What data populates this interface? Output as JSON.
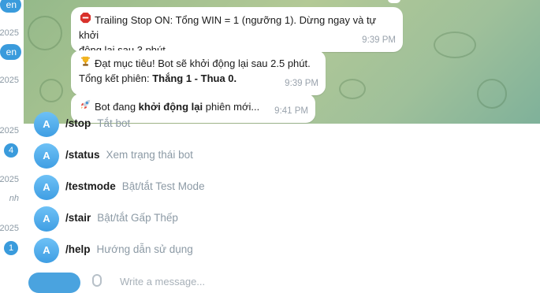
{
  "chat_list": {
    "years": [
      "2025",
      "2025",
      "2025",
      "2025",
      "2025",
      "2025"
    ],
    "pills": [
      "en",
      "en"
    ],
    "badges": [
      "4",
      "1"
    ],
    "italic_snippet": "nh"
  },
  "messages": [
    {
      "icon": "stop-sign-icon",
      "text_line1": "Trailing Stop ON: Tổng WIN = 1 (ngưỡng 1). Dừng ngay và tự khởi",
      "text_line2": "động lại sau 3 phút.",
      "time": "9:39 PM"
    },
    {
      "icon": "trophy-icon",
      "text_line1": "Đạt mục tiêu! Bot sẽ khởi động lại sau 2.5 phút.",
      "text_line2_prefix": "Tổng kết phiên: ",
      "text_line2_bold": "Thắng 1 - Thua 0.",
      "time": "9:39 PM"
    },
    {
      "icon": "rocket-icon",
      "text_prefix": "Bot đang ",
      "text_bold": "khởi động lại",
      "text_suffix": " phiên mới...",
      "time": "9:41 PM"
    }
  ],
  "commands": [
    {
      "avatar_letter": "A",
      "command": "/stop",
      "description": "Tắt bot"
    },
    {
      "avatar_letter": "A",
      "command": "/status",
      "description": "Xem trạng thái bot"
    },
    {
      "avatar_letter": "A",
      "command": "/testmode",
      "description": "Bật/tắt Test Mode"
    },
    {
      "avatar_letter": "A",
      "command": "/stair",
      "description": "Bật/tắt Gấp Thếp"
    },
    {
      "avatar_letter": "A",
      "command": "/help",
      "description": "Hướng dẫn sử dụng"
    }
  ],
  "composer": {
    "placeholder": "Write a message..."
  },
  "colors": {
    "accent": "#3a9bdc",
    "wallpaper": "#a6c48f"
  }
}
